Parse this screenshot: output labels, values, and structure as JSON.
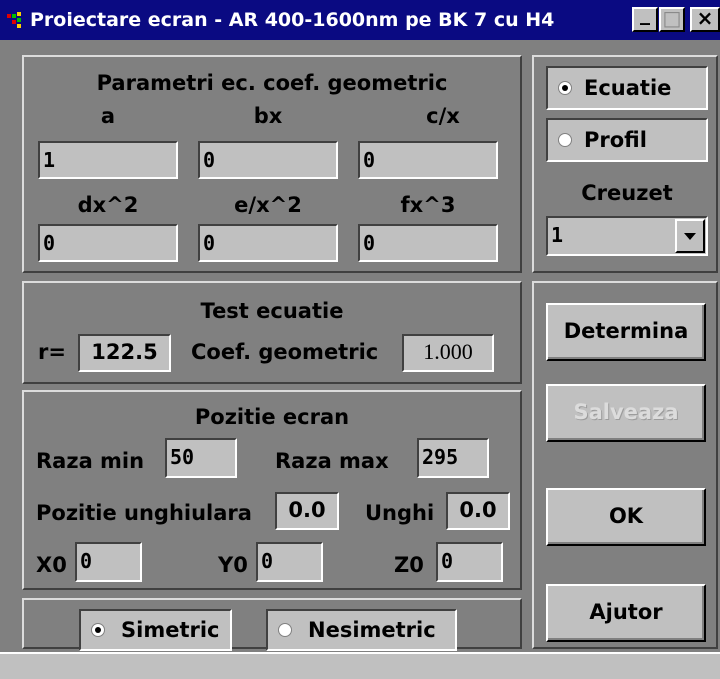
{
  "window": {
    "title": "Proiectare ecran - AR 400-1600nm pe BK 7 cu H4",
    "minimize_glyph": "_",
    "maximize_glyph": "□",
    "close_glyph": "×"
  },
  "colors": {
    "titlebar": "#0a0a82",
    "face": "#c0c0c0",
    "panel": "#808080"
  },
  "geometric": {
    "heading": "Parametri ec. coef. geometric",
    "labels": [
      "a",
      "bx",
      "c/x",
      "dx^2",
      "e/x^2",
      "fx^3"
    ],
    "values": [
      "1",
      "0",
      "0",
      "0",
      "0",
      "0"
    ]
  },
  "mode": {
    "options": [
      "Ecuatie",
      "Profil"
    ],
    "selected": "Ecuatie",
    "creuzet_label": "Creuzet",
    "creuzet_value": "1"
  },
  "test": {
    "heading": "Test ecuatie",
    "r_label": "r=",
    "r_value": "122.5",
    "coef_label": "Coef. geometric",
    "coef_value": "1.000"
  },
  "position": {
    "heading": "Pozitie ecran",
    "raza_min_label": "Raza min",
    "raza_min_value": "50",
    "raza_max_label": "Raza max",
    "raza_max_value": "295",
    "pozitie_label": "Pozitie unghiulara",
    "pozitie_value": "0.0",
    "unghi_label": "Unghi",
    "unghi_value": "0.0",
    "x0_label": "X0",
    "x0_value": "0",
    "y0_label": "Y0",
    "y0_value": "0",
    "z0_label": "Z0",
    "z0_value": "0"
  },
  "symmetry": {
    "options": [
      "Simetric",
      "Nesimetric"
    ],
    "selected": "Simetric"
  },
  "buttons": {
    "determina": "Determina",
    "salveaza": "Salveaza",
    "ok": "OK",
    "ajutor": "Ajutor"
  },
  "icons": {
    "app": "app-icon",
    "dropdown": "chevron-down-icon"
  }
}
